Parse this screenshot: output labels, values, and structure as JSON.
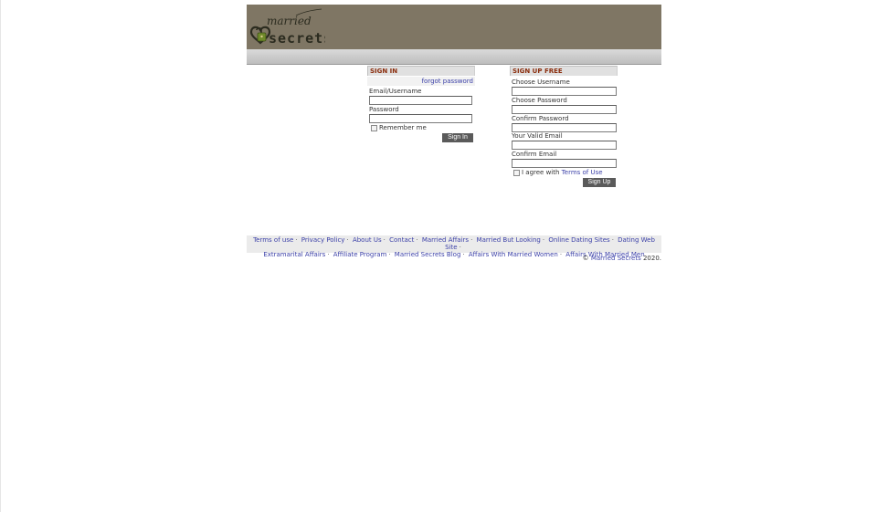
{
  "brand": {
    "logo_top": "married",
    "logo_bottom": "secrets",
    "colors": {
      "header_bg": "#7f7664",
      "title_text": "#8b2e0e",
      "link": "#3c41a8",
      "button_bg": "#5a5a5a"
    }
  },
  "signin": {
    "title": "SIGN IN",
    "forgot": "forgot password",
    "email_label": "Email/Username",
    "password_label": "Password",
    "remember_label": "Remember me",
    "button": "Sign In"
  },
  "signup": {
    "title": "SIGN UP FREE",
    "username_label": "Choose Username",
    "password_label": "Choose Password",
    "confirm_password_label": "Confirm Password",
    "email_label": "Your Valid Email",
    "confirm_email_label": "Confirm Email",
    "agree_prefix": "I agree with",
    "terms_link": "Terms of Use",
    "button": "Sign Up"
  },
  "footer": {
    "links_row1": [
      "Terms of use",
      "Privacy Policy",
      "About Us",
      "Contact",
      "Married Affairs",
      "Married But Looking",
      "Online Dating Sites",
      "Dating Web Site"
    ],
    "links_row2": [
      "Extramarital Affairs",
      "Affiliate Program",
      "Married Secrets Blog",
      "Affairs With Married Women",
      "Affairs With Married Men"
    ],
    "copyright_symbol": "©",
    "copyright_link": "Married Secrets",
    "copyright_year": "2020."
  }
}
